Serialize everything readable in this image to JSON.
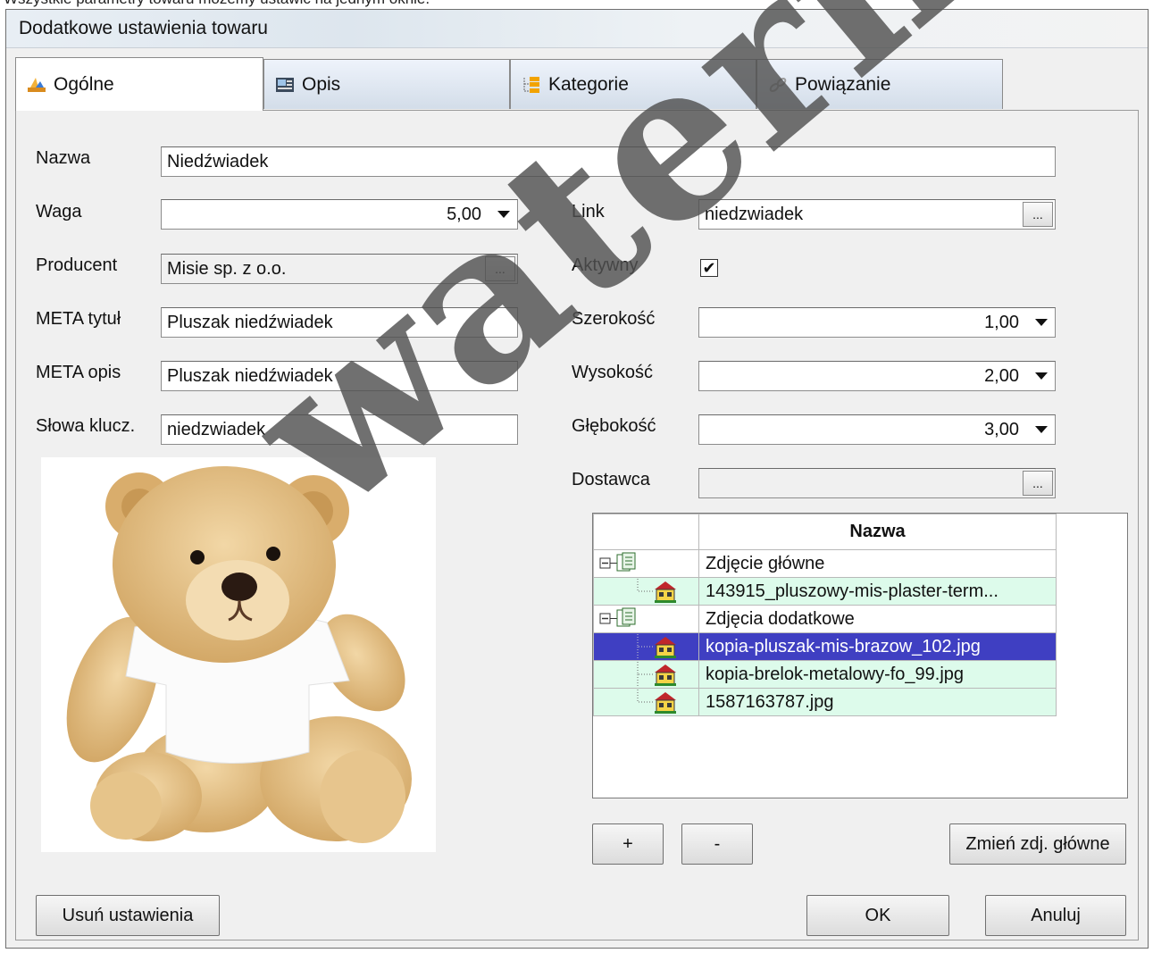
{
  "caption": "Wszystkie parametry towaru możemy ustawić na jednym oknie.",
  "window": {
    "title": "Dodatkowe ustawienia towaru"
  },
  "tabs": [
    {
      "label": "Ogólne",
      "icon": "general-icon",
      "active": true
    },
    {
      "label": "Opis",
      "icon": "description-icon",
      "active": false
    },
    {
      "label": "Kategorie",
      "icon": "categories-icon",
      "active": false
    },
    {
      "label": "Powiązanie",
      "icon": "link-icon",
      "active": false
    }
  ],
  "form": {
    "nazwa": {
      "label": "Nazwa",
      "value": "Niedźwiadek"
    },
    "waga": {
      "label": "Waga",
      "value": "5,00"
    },
    "producent": {
      "label": "Producent",
      "value": "Misie sp. z o.o.",
      "button": "..."
    },
    "meta_tytul": {
      "label": "META tytuł",
      "value": "Pluszak niedźwiadek"
    },
    "meta_opis": {
      "label": "META opis",
      "value": "Pluszak niedźwiadek"
    },
    "slowa_klucz": {
      "label": "Słowa klucz.",
      "value": "niedzwiadek"
    },
    "link": {
      "label": "Link",
      "value": "niedzwiadek",
      "button": "..."
    },
    "aktywny": {
      "label": "Aktywny",
      "checked": true,
      "mark": "✔"
    },
    "szerokosc": {
      "label": "Szerokość",
      "value": "1,00"
    },
    "wysokosc": {
      "label": "Wysokość",
      "value": "2,00"
    },
    "glebokosc": {
      "label": "Głębokość",
      "value": "3,00"
    },
    "dostawca": {
      "label": "Dostawca",
      "value": "",
      "button": "..."
    }
  },
  "images_grid": {
    "header": "Nazwa",
    "rows": [
      {
        "type": "group",
        "name": "Zdjęcie główne"
      },
      {
        "type": "file",
        "name": "143915_pluszowy-mis-plaster-term..."
      },
      {
        "type": "group",
        "name": "Zdjęcia dodatkowe"
      },
      {
        "type": "file",
        "name": "kopia-pluszak-mis-brazow_102.jpg",
        "selected": true
      },
      {
        "type": "file",
        "name": "kopia-brelok-metalowy-fo_99.jpg"
      },
      {
        "type": "file",
        "name": "1587163787.jpg"
      }
    ]
  },
  "buttons": {
    "add": "+",
    "remove": "-",
    "change_main": "Zmień zdj. główne",
    "delete_settings": "Usuń ustawienia",
    "ok": "OK",
    "cancel": "Anuluj"
  },
  "watermark": "waterma"
}
